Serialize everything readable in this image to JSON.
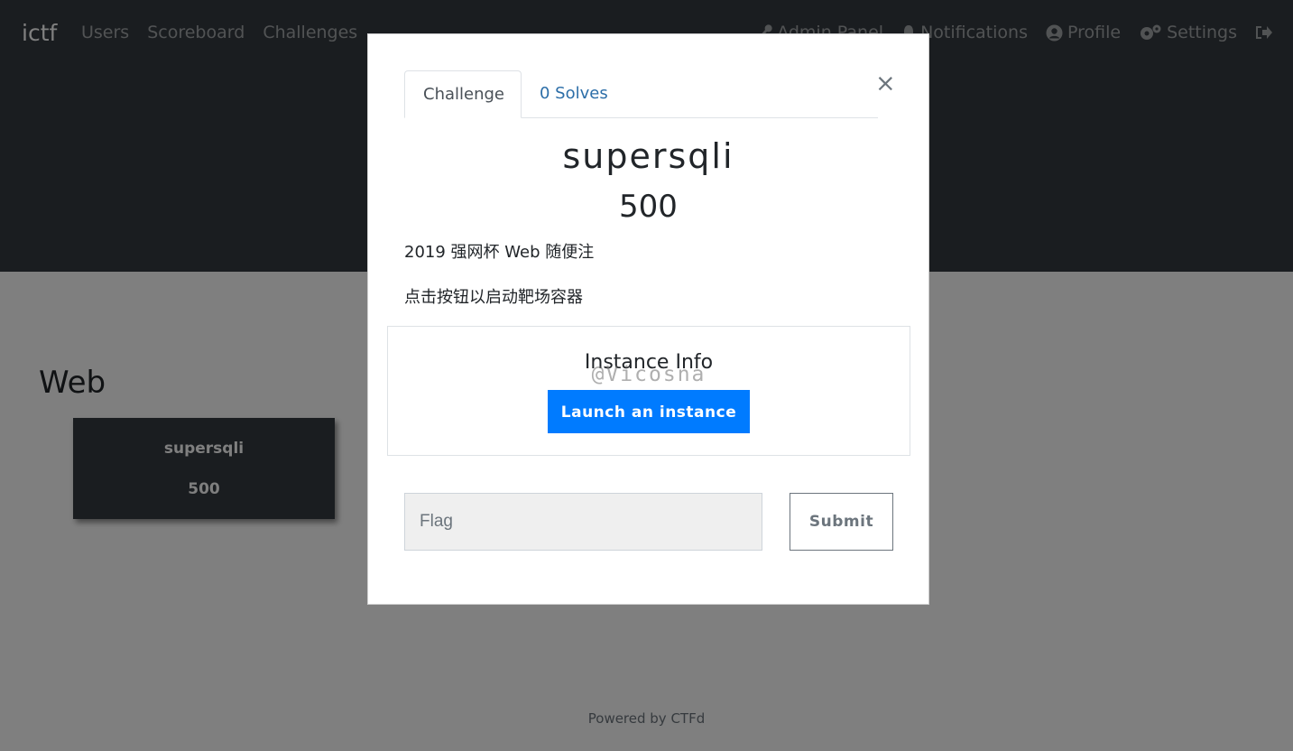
{
  "navbar": {
    "brand": "ictf",
    "left_items": [
      "Users",
      "Scoreboard",
      "Challenges"
    ],
    "right_items": [
      {
        "label": "Admin Panel",
        "icon": "wrench-icon"
      },
      {
        "label": "Notifications",
        "icon": "bell-icon"
      },
      {
        "label": "Profile",
        "icon": "user-circle-icon"
      },
      {
        "label": "Settings",
        "icon": "cogs-icon"
      },
      {
        "label": "",
        "icon": "logout-icon"
      }
    ]
  },
  "board": {
    "category": "Web",
    "card": {
      "name": "supersqli",
      "value": "500"
    }
  },
  "footer": {
    "text": "Powered by CTFd"
  },
  "modal": {
    "tabs": {
      "challenge": "Challenge",
      "solves": "0 Solves"
    },
    "close_symbol": "×",
    "name": "supersqli",
    "value": "500",
    "description": [
      "2019 强网杯 Web 随便注",
      "点击按钮以启动靶场容器"
    ],
    "instance": {
      "title": "Instance Info",
      "launch_label": "Launch an instance",
      "watermark": "@Vicosna"
    },
    "flag": {
      "placeholder": "Flag",
      "value": ""
    },
    "submit_label": "Submit"
  },
  "colors": {
    "navbar_bg": "#343a40",
    "primary": "#007bff",
    "link": "#2c6ea8",
    "backdrop": "rgba(0,0,0,0.5)"
  }
}
